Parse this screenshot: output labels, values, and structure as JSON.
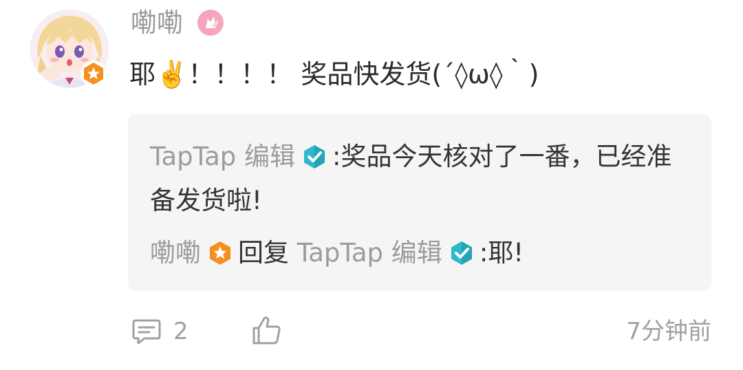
{
  "comment": {
    "author": "嘞嘞",
    "text": "耶✌️！！！！ 奖品快发货(´◊ω◊｀)"
  },
  "replies": [
    {
      "author": "TapTap 编辑",
      "text": ":奖品今天核对了一番，已经准备发货啦!"
    },
    {
      "author": "嘞嘞",
      "reply_word": "回复",
      "reply_to": "TapTap 编辑",
      "text": ":耶!"
    }
  ],
  "footer": {
    "comment_count": "2",
    "time": "7分钟前"
  },
  "colors": {
    "verified_badge": "#2fb7cc",
    "level_badge": "#f5901e",
    "year_badge": "#f4a6bd"
  },
  "icons": {
    "avatar": "anime-avatar",
    "level": "hexagon-star-badge-icon",
    "verified": "hexagon-check-badge-icon",
    "year": "year-badge-icon",
    "comment": "comment-bubble-icon",
    "like": "thumbs-up-icon"
  }
}
